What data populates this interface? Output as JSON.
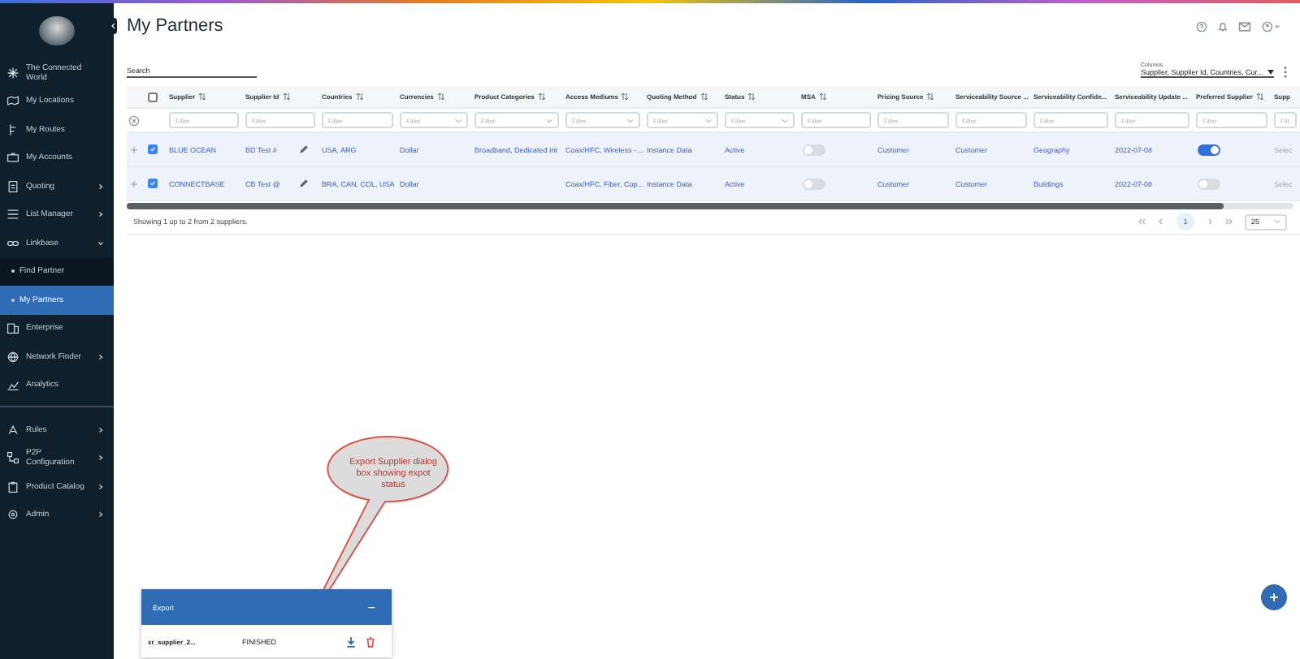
{
  "sidebar": {
    "sections": [
      {
        "items": [
          {
            "label": "The Connected World",
            "submenu": false
          },
          {
            "label": "My Locations",
            "submenu": false
          },
          {
            "label": "My Routes",
            "submenu": false
          },
          {
            "label": "My Accounts",
            "submenu": false
          },
          {
            "label": "Quoting",
            "submenu": true,
            "expanded": false
          },
          {
            "label": "List Manager",
            "submenu": true,
            "expanded": false
          },
          {
            "label": "Linkbase",
            "submenu": true,
            "expanded": true,
            "children": [
              {
                "label": "Find Partner",
                "selected": false
              },
              {
                "label": "My Partners",
                "selected": true
              }
            ]
          },
          {
            "label": "Enterprise",
            "submenu": false
          },
          {
            "label": "Network Finder",
            "submenu": true,
            "expanded": false
          },
          {
            "label": "Analytics",
            "submenu": false
          }
        ]
      },
      {
        "items": [
          {
            "label": "Rules",
            "submenu": true,
            "expanded": false
          },
          {
            "label": "P2P Configuration",
            "submenu": true,
            "expanded": false
          },
          {
            "label": "Product Catalog",
            "submenu": true,
            "expanded": false
          },
          {
            "label": "Admin",
            "submenu": true,
            "expanded": false
          }
        ]
      }
    ]
  },
  "page": {
    "title": "My Partners"
  },
  "toolbar": {
    "search_label": "Search",
    "columns_label": "Columns",
    "columns_value": "Supplier, Supplier Id, Countries, Cur..."
  },
  "table": {
    "select_all_checked": false,
    "columns": [
      {
        "label": "Supplier",
        "sortable": true,
        "filter_placeholder": "Filter",
        "filter_dropdown": false
      },
      {
        "label": "Supplier Id",
        "sortable": true,
        "filter_placeholder": "Filter",
        "filter_dropdown": false
      },
      {
        "label": "Countries",
        "sortable": true,
        "filter_placeholder": "Filter",
        "filter_dropdown": false
      },
      {
        "label": "Currencies",
        "sortable": true,
        "filter_placeholder": "Filter",
        "filter_dropdown": true
      },
      {
        "label": "Product Categories",
        "sortable": true,
        "filter_placeholder": "Filter",
        "filter_dropdown": true
      },
      {
        "label": "Access Mediums",
        "sortable": true,
        "filter_placeholder": "Filter",
        "filter_dropdown": true
      },
      {
        "label": "Quoting Method",
        "sortable": true,
        "filter_placeholder": "Filter",
        "filter_dropdown": true
      },
      {
        "label": "Status",
        "sortable": true,
        "filter_placeholder": "Filter",
        "filter_dropdown": true
      },
      {
        "label": "MSA",
        "sortable": true,
        "filter_placeholder": "Filter",
        "filter_dropdown": false
      },
      {
        "label": "Pricing Source",
        "sortable": true,
        "filter_placeholder": "Filter",
        "filter_dropdown": false
      },
      {
        "label": "Serviceability Source ...",
        "filter_placeholder": "Filter",
        "filter_dropdown": false
      },
      {
        "label": "Serviceability Confide...",
        "sortable": false,
        "filter_placeholder": "Filter",
        "filter_dropdown": false
      },
      {
        "label": "Serviceability Update ...",
        "sortable": false,
        "filter_placeholder": "Filter",
        "filter_dropdown": false
      },
      {
        "label": "Preferred Supplier",
        "sortable": true,
        "filter_placeholder": "Filter",
        "filter_dropdown": false
      },
      {
        "label": "Supp",
        "filter_placeholder": "Filt"
      }
    ],
    "rows": [
      {
        "expanded": false,
        "checked": true,
        "cells": [
          {
            "kind": "text",
            "text": "BLUE OCEAN"
          },
          {
            "kind": "edit",
            "text": "BD Test #"
          },
          {
            "kind": "text",
            "text": "USA, ARG"
          },
          {
            "kind": "text",
            "text": "Dollar"
          },
          {
            "kind": "text",
            "text": "Broadband, Dedicated Int"
          },
          {
            "kind": "text",
            "text": "Coax/HFC, Wireless - ..."
          },
          {
            "kind": "text",
            "text": "Instance Data"
          },
          {
            "kind": "text",
            "text": "Active"
          },
          {
            "kind": "toggle",
            "on": false
          },
          {
            "kind": "text",
            "text": "Customer"
          },
          {
            "kind": "text",
            "text": "Customer"
          },
          {
            "kind": "text",
            "text": "Geography"
          },
          {
            "kind": "text",
            "text": "2022-07-08"
          },
          {
            "kind": "toggle",
            "on": true
          },
          {
            "kind": "muted",
            "text": "Selec"
          }
        ]
      },
      {
        "expanded": false,
        "checked": true,
        "cells": [
          {
            "kind": "text",
            "text": "CONNECTBASE"
          },
          {
            "kind": "edit",
            "text": "CB Test @"
          },
          {
            "kind": "text",
            "text": "BRA, CAN, COL, USA"
          },
          {
            "kind": "text",
            "text": "Dollar"
          },
          {
            "kind": "text"
          },
          {
            "kind": "text",
            "text": "Coax/HFC, Fiber, Cop..."
          },
          {
            "kind": "text",
            "text": "Instance Data"
          },
          {
            "kind": "text",
            "text": "Active"
          },
          {
            "kind": "toggle",
            "on": false
          },
          {
            "kind": "text",
            "text": "Customer"
          },
          {
            "kind": "text",
            "text": "Customer"
          },
          {
            "kind": "text",
            "text": "Buildings"
          },
          {
            "kind": "text",
            "text": "2022-07-08"
          },
          {
            "kind": "toggle",
            "on": false
          },
          {
            "kind": "muted",
            "text": "Selec"
          }
        ]
      }
    ]
  },
  "summary": "Showing 1 up to 2 from 2 suppliers.",
  "pagination": {
    "pages": [
      {
        "label": "1",
        "selected": true
      }
    ],
    "page_size": "25"
  },
  "annotation": {
    "text": "Export Supplier dialog box showing expot status"
  },
  "export_panel": {
    "title": "Export",
    "minimize": "−",
    "items": [
      {
        "name": "xr_supplier_2...",
        "status": "FINISHED"
      }
    ]
  }
}
